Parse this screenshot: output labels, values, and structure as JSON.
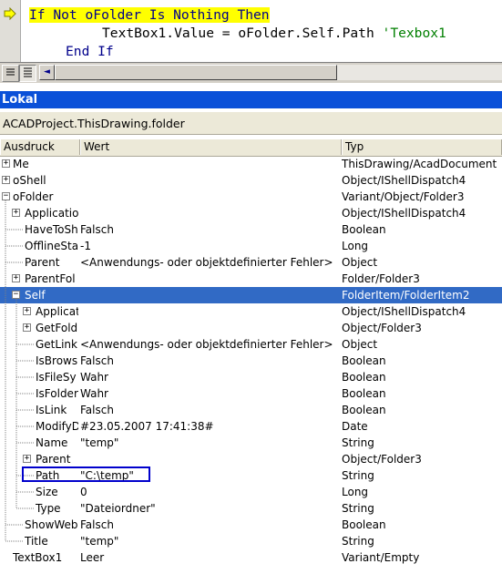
{
  "editor": {
    "line1": "If Not oFolder Is Nothing Then",
    "line2_code": "TextBox1.Value = oFolder.Self.Path ",
    "line2_comment": "'Texbox1",
    "line3": "End If"
  },
  "editor_bar": {
    "view_procedure_icon": "procedure-view-icon",
    "view_full_icon": "full-module-view-icon",
    "scroll_left_glyph": "◄"
  },
  "window": {
    "title": "Lokal",
    "context": "ACADProject.ThisDrawing.folder"
  },
  "columns": {
    "expression": "Ausdruck",
    "value": "Wert",
    "type": "Typ"
  },
  "rows": [
    {
      "name": "Me",
      "value": "",
      "type": "ThisDrawing/AcadDocument",
      "expander": "+",
      "indent": 0
    },
    {
      "name": "oShell",
      "value": "",
      "type": "Object/IShellDispatch4",
      "expander": "+",
      "indent": 0
    },
    {
      "name": "oFolder",
      "value": "",
      "type": "Variant/Object/Folder3",
      "expander": "-",
      "indent": 0
    },
    {
      "name": "Applicatio",
      "value": "",
      "type": "Object/IShellDispatch4",
      "expander": "+",
      "indent": 1
    },
    {
      "name": "HaveToSh",
      "value": "Falsch",
      "type": "Boolean",
      "expander": "",
      "indent": 1
    },
    {
      "name": "OfflineStat",
      "value": "-1",
      "type": "Long",
      "expander": "",
      "indent": 1
    },
    {
      "name": "Parent",
      "value": "<Anwendungs- oder objektdefinierter Fehler>",
      "type": "Object",
      "expander": "",
      "indent": 1
    },
    {
      "name": "ParentFol",
      "value": "",
      "type": "Folder/Folder3",
      "expander": "+",
      "indent": 1
    },
    {
      "name": "Self",
      "value": "",
      "type": "FolderItem/FolderItem2",
      "expander": "-",
      "indent": 1,
      "selected": true
    },
    {
      "name": "Applicat",
      "value": "",
      "type": "Object/IShellDispatch4",
      "expander": "+",
      "indent": 2
    },
    {
      "name": "GetFold",
      "value": "",
      "type": "Object/Folder3",
      "expander": "+",
      "indent": 2
    },
    {
      "name": "GetLink",
      "value": "<Anwendungs- oder objektdefinierter Fehler>",
      "type": "Object",
      "expander": "",
      "indent": 2
    },
    {
      "name": "IsBrows",
      "value": "Falsch",
      "type": "Boolean",
      "expander": "",
      "indent": 2
    },
    {
      "name": "IsFileSy",
      "value": "Wahr",
      "type": "Boolean",
      "expander": "",
      "indent": 2
    },
    {
      "name": "IsFolder",
      "value": "Wahr",
      "type": "Boolean",
      "expander": "",
      "indent": 2
    },
    {
      "name": "IsLink",
      "value": "Falsch",
      "type": "Boolean",
      "expander": "",
      "indent": 2
    },
    {
      "name": "ModifyD",
      "value": "#23.05.2007 17:41:38#",
      "type": "Date",
      "expander": "",
      "indent": 2
    },
    {
      "name": "Name",
      "value": "\"temp\"",
      "type": "String",
      "expander": "",
      "indent": 2
    },
    {
      "name": "Parent",
      "value": "",
      "type": "Object/Folder3",
      "expander": "+",
      "indent": 2
    },
    {
      "name": "Path",
      "value": "\"C:\\temp\"",
      "type": "String",
      "expander": "",
      "indent": 2,
      "highlighted": true
    },
    {
      "name": "Size",
      "value": "0",
      "type": "Long",
      "expander": "",
      "indent": 2
    },
    {
      "name": "Type",
      "value": "\"Dateiordner\"",
      "type": "String",
      "expander": "",
      "indent": 2
    },
    {
      "name": "ShowWeb",
      "value": "Falsch",
      "type": "Boolean",
      "expander": "",
      "indent": 1
    },
    {
      "name": "Title",
      "value": "\"temp\"",
      "type": "String",
      "expander": "",
      "indent": 1
    },
    {
      "name": "TextBox1",
      "value": "Leer",
      "type": "Variant/Empty",
      "expander": "",
      "indent": 0,
      "noline": true
    }
  ],
  "colors": {
    "title_bar": "#0a50d8",
    "selection": "#316ac5",
    "highlight_box": "#0000cc",
    "exec_highlight": "#ffff00",
    "keyword": "#00008b",
    "comment": "#007f00"
  }
}
